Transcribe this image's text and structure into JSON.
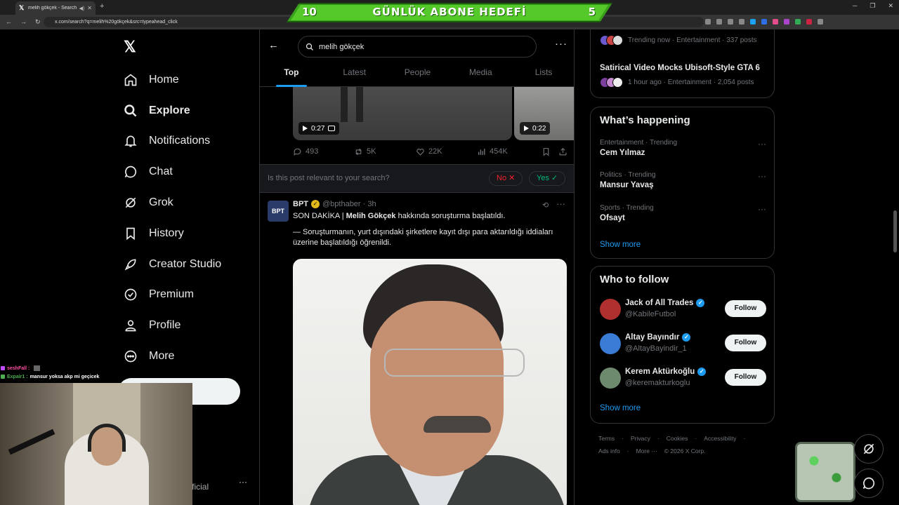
{
  "browser": {
    "tab_title": "melih gökçek - Search / X",
    "url": "x.com/search?q=melih%20gökçek&src=typeahead_click",
    "tab_icon": "x-logo-icon"
  },
  "overlay": {
    "goal_left": "10",
    "goal_text": "GÜNLÜK ABONE HEDEFİ",
    "goal_right": "5",
    "chat": [
      {
        "user": "seshFall :",
        "msg": "",
        "color": "#ff4fa3"
      },
      {
        "user": "Expair1 :",
        "msg": "mansur yoksa akp mi geçicek",
        "color": "#4caf50"
      }
    ]
  },
  "sidebar": {
    "logo": "𝕏",
    "items": [
      {
        "label": "Home",
        "icon": "home-icon"
      },
      {
        "label": "Explore",
        "icon": "search-icon"
      },
      {
        "label": "Notifications",
        "icon": "bell-icon"
      },
      {
        "label": "Chat",
        "icon": "chat-icon"
      },
      {
        "label": "Grok",
        "icon": "grok-icon"
      },
      {
        "label": "History",
        "icon": "bookmark-icon"
      },
      {
        "label": "Creator Studio",
        "icon": "rocket-icon"
      },
      {
        "label": "Premium",
        "icon": "verified-icon"
      },
      {
        "label": "Profile",
        "icon": "person-icon"
      },
      {
        "label": "More",
        "icon": "more-circle-icon"
      }
    ],
    "account_fragment": "fficial",
    "account_more": "···"
  },
  "search": {
    "query": "melih gökçek",
    "tabs": [
      "Top",
      "Latest",
      "People",
      "Media",
      "Lists"
    ],
    "active_tab": "Top"
  },
  "feed": {
    "video1_duration": "0:27",
    "video2_duration": "0:22",
    "stats": {
      "replies": "493",
      "reposts": "5K",
      "likes": "22K",
      "views": "454K"
    },
    "relevance_question": "Is this post relevant to your search?",
    "relevance_no": "No ✕",
    "relevance_yes": "Yes ✓",
    "post": {
      "name": "BPT",
      "handle": "@bpthaber · 3h",
      "avatar_text": "BPT",
      "line1_prefix": "SON DAKİKA | ",
      "line1_bold": "Melih Gökçek",
      "line1_suffix": " hakkında soruşturma başlatıldı.",
      "line2": "— Soruşturmanın, yurt dışındaki şirketlere kayıt dışı para aktarıldığı iddiaları üzerine başlatıldığı öğrenildi."
    }
  },
  "right": {
    "trend_top_meta": "Trending now · Entertainment · 337 posts",
    "trend_gta_title": "Satirical Video Mocks Ubisoft-Style GTA 6",
    "trend_gta_meta": "1 hour ago · Entertainment · 2,054 posts",
    "happening_title": "What’s happening",
    "trends": [
      {
        "meta": "Entertainment · Trending",
        "name": "Cem Yılmaz"
      },
      {
        "meta": "Politics · Trending",
        "name": "Mansur Yavaş"
      },
      {
        "meta": "Sports · Trending",
        "name": "Ofsayt"
      }
    ],
    "show_more": "Show more",
    "wtf_title": "Who to follow",
    "follow_label": "Follow",
    "who_to_follow": [
      {
        "name": "Jack of All Trades",
        "handle": "@KabileFutbol",
        "color": "#b03030"
      },
      {
        "name": "Altay Bayındır",
        "handle": "@AltayBayindir_1",
        "color": "#3a7bd5"
      },
      {
        "name": "Kerem Aktürkoğlu",
        "handle": "@keremakturkoglu",
        "color": "#6e8a6e"
      }
    ],
    "footer_row1": [
      "Terms",
      "·",
      "Privacy",
      "·",
      "Cookies",
      "·",
      "Accessibility",
      "·"
    ],
    "footer_row2": [
      "Ads info",
      "·",
      "More ···",
      "© 2026 X Corp."
    ]
  }
}
